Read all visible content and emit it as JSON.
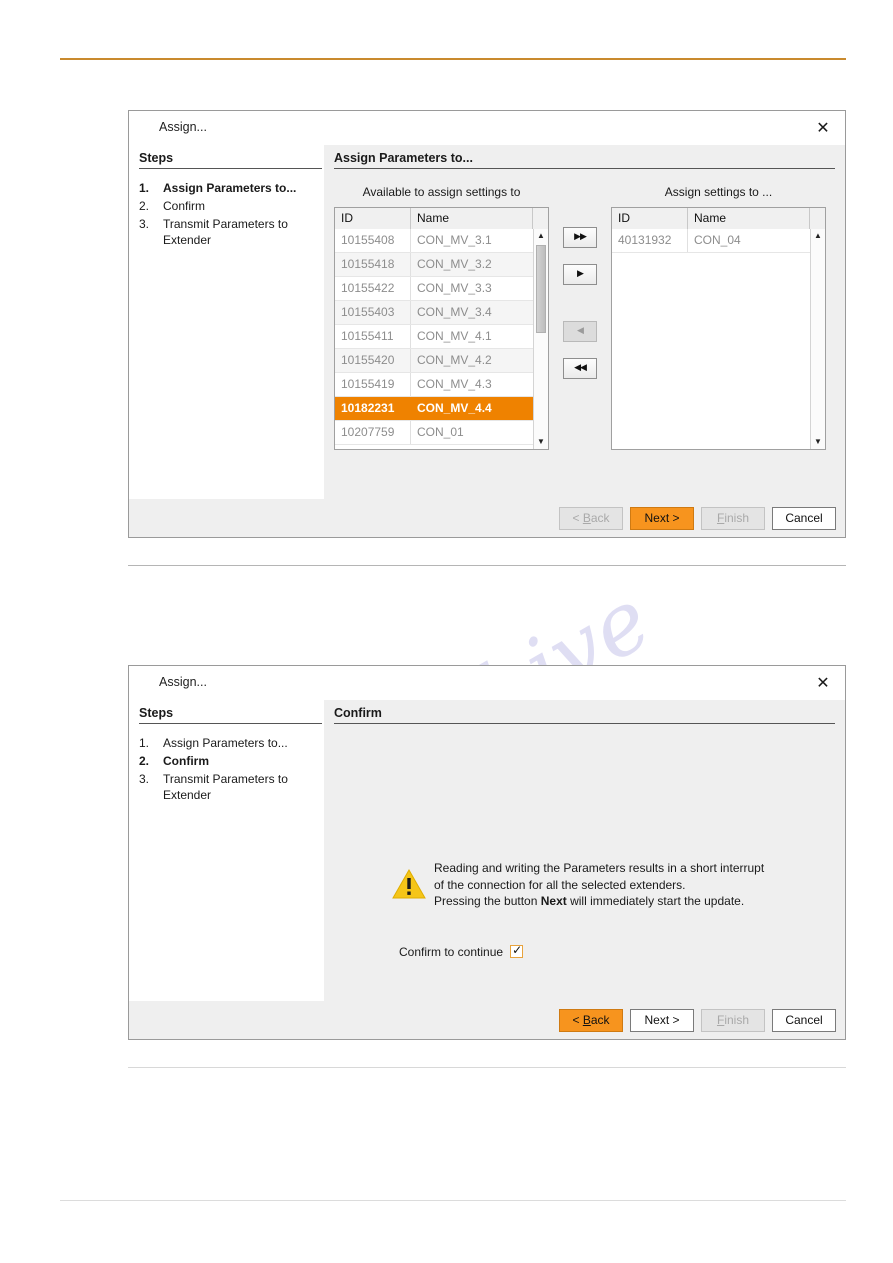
{
  "page": {
    "rules": [
      "top-orange-rule",
      "mid-gray-rule",
      "low-gray-rule",
      "bottom-gray-rule"
    ],
    "watermark_1": "ive.com",
    "watermark_2": "manualshive"
  },
  "colors": {
    "accent_orange": "#ef8200",
    "button_orange": "#f7941e",
    "rule_orange": "#c98a2e",
    "warning_yellow": "#f5c518",
    "panel_gray": "#efefef",
    "disabled_text": "#a9a9a9"
  },
  "dialog_assign": {
    "title": "Assign...",
    "close_label": "✕",
    "steps_header": "Steps",
    "steps": [
      {
        "num": "1.",
        "label": "Assign Parameters to...",
        "active": true
      },
      {
        "num": "2.",
        "label": "Confirm",
        "active": false
      },
      {
        "num": "3.",
        "label": "Transmit Parameters to Extender",
        "active": false
      }
    ],
    "content_header": "Assign Parameters to...",
    "left_list": {
      "caption": "Available to assign settings to",
      "columns": [
        "ID",
        "Name"
      ],
      "rows": [
        {
          "id": "10155408",
          "name": "CON_MV_3.1",
          "selected": false
        },
        {
          "id": "10155418",
          "name": "CON_MV_3.2",
          "selected": false
        },
        {
          "id": "10155422",
          "name": "CON_MV_3.3",
          "selected": false
        },
        {
          "id": "10155403",
          "name": "CON_MV_3.4",
          "selected": false
        },
        {
          "id": "10155411",
          "name": "CON_MV_4.1",
          "selected": false
        },
        {
          "id": "10155420",
          "name": "CON_MV_4.2",
          "selected": false
        },
        {
          "id": "10155419",
          "name": "CON_MV_4.3",
          "selected": false
        },
        {
          "id": "10182231",
          "name": "CON_MV_4.4",
          "selected": true
        },
        {
          "id": "10207759",
          "name": "CON_01",
          "selected": false
        }
      ]
    },
    "right_list": {
      "caption": "Assign settings to ...",
      "columns": [
        "ID",
        "Name"
      ],
      "rows": [
        {
          "id": "40131932",
          "name": "CON_04",
          "selected": false
        }
      ]
    },
    "transfer_buttons": [
      {
        "icon": "▶▶",
        "name": "move-all-right-button",
        "disabled": false
      },
      {
        "icon": "▶",
        "name": "move-right-button",
        "disabled": false
      },
      {
        "icon": "◀",
        "name": "move-left-button",
        "disabled": true
      },
      {
        "icon": "◀◀",
        "name": "move-all-left-button",
        "disabled": false
      }
    ],
    "footer": {
      "back": {
        "prefix": "< ",
        "mnemonic": "B",
        "suffix": "ack",
        "state": "disabled"
      },
      "next": {
        "label": "Next >",
        "state": "primary"
      },
      "finish": {
        "prefix": "",
        "mnemonic": "F",
        "suffix": "inish",
        "state": "disabled"
      },
      "cancel": {
        "label": "Cancel",
        "state": "normal"
      }
    }
  },
  "dialog_confirm": {
    "title": "Assign...",
    "close_label": "✕",
    "steps_header": "Steps",
    "steps": [
      {
        "num": "1.",
        "label": "Assign Parameters to...",
        "active": false
      },
      {
        "num": "2.",
        "label": "Confirm",
        "active": true
      },
      {
        "num": "3.",
        "label": "Transmit Parameters to Extender",
        "active": false
      }
    ],
    "content_header": "Confirm",
    "warning": {
      "line1": "Reading and writing the Parameters results in a short interrupt",
      "line2": "of the connection for all the selected extenders.",
      "line3_pre": "Pressing the button ",
      "line3_bold": "Next",
      "line3_post": " will immediately start the update."
    },
    "confirm_checkbox": {
      "label": "Confirm to continue",
      "checked": true,
      "tick": "✓"
    },
    "footer": {
      "back": {
        "prefix": "< ",
        "mnemonic": "B",
        "suffix": "ack",
        "state": "primary"
      },
      "next": {
        "label": "Next >",
        "state": "normal"
      },
      "finish": {
        "prefix": "",
        "mnemonic": "F",
        "suffix": "inish",
        "state": "disabled"
      },
      "cancel": {
        "label": "Cancel",
        "state": "normal"
      }
    }
  }
}
